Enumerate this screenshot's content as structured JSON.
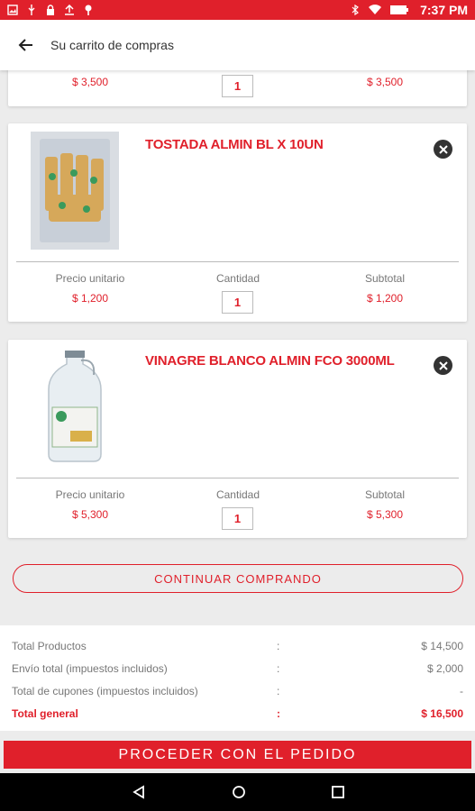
{
  "status_bar": {
    "time": "7:37 PM",
    "accent": "#e0202b"
  },
  "app_bar": {
    "title": "Su carrito de compras",
    "back_icon": "arrow-left-icon"
  },
  "partial_item": {
    "unit_price": "$ 3,500",
    "quantity": "1",
    "subtotal": "$ 3,500"
  },
  "cart_items": [
    {
      "name": "TOSTADA ALMIN BL X 10UN",
      "unit_price_label": "Precio unitario",
      "unit_price": "$ 1,200",
      "quantity_label": "Cantidad",
      "quantity": "1",
      "subtotal_label": "Subtotal",
      "subtotal": "$ 1,200"
    },
    {
      "name": "VINAGRE BLANCO ALMIN FCO 3000ML",
      "unit_price_label": "Precio unitario",
      "unit_price": "$ 5,300",
      "quantity_label": "Cantidad",
      "quantity": "1",
      "subtotal_label": "Subtotal",
      "subtotal": "$ 5,300"
    }
  ],
  "continue_label": "CONTINUAR COMPRANDO",
  "totals": {
    "rows": [
      {
        "label": "Total Productos",
        "sep": ":",
        "value": "$ 14,500"
      },
      {
        "label": "Envío total (impuestos incluidos)",
        "sep": ":",
        "value": "$ 2,000"
      },
      {
        "label": "Total de cupones (impuestos incluidos)",
        "sep": ":",
        "value": "-"
      },
      {
        "label": "Total general",
        "sep": ":",
        "value": "$ 16,500"
      }
    ]
  },
  "proceed_label": "PROCEDER CON EL PEDIDO"
}
